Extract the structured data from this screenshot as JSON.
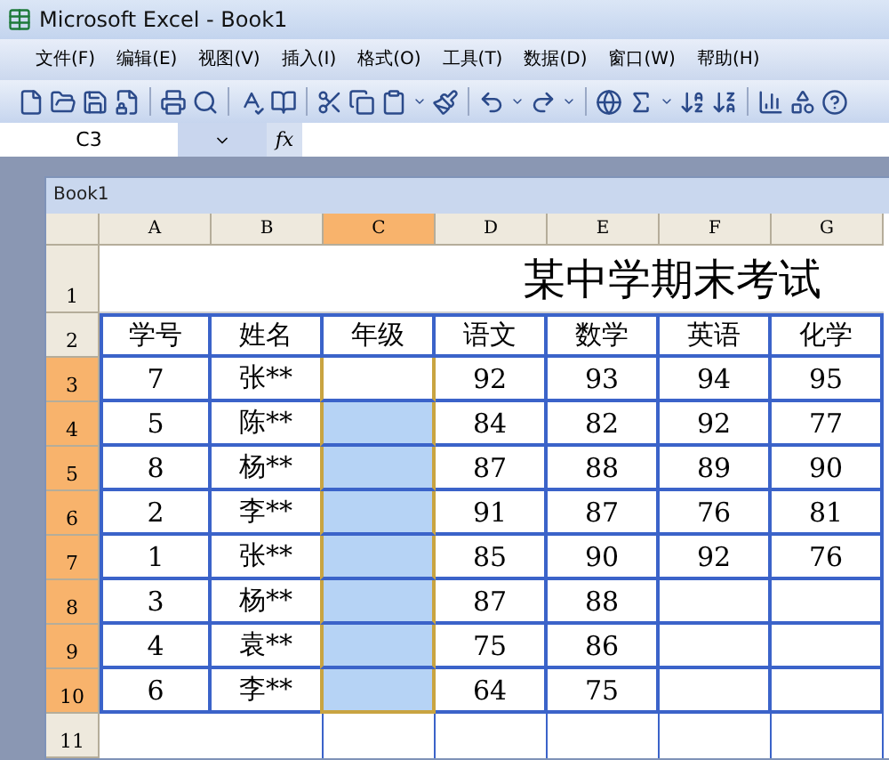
{
  "window": {
    "title": "Microsoft Excel - Book1"
  },
  "menu": [
    "文件(F)",
    "编辑(E)",
    "视图(V)",
    "插入(I)",
    "格式(O)",
    "工具(T)",
    "数据(D)",
    "窗口(W)",
    "帮助(H)"
  ],
  "name_box": "C3",
  "fx": "fx",
  "workbook": {
    "title": "Book1"
  },
  "columns": [
    {
      "label": "A",
      "selected": false
    },
    {
      "label": "B",
      "selected": false
    },
    {
      "label": "C",
      "selected": true
    },
    {
      "label": "D",
      "selected": false
    },
    {
      "label": "E",
      "selected": false
    },
    {
      "label": "F",
      "selected": false
    },
    {
      "label": "G",
      "selected": false
    }
  ],
  "sheet_title": "某中学期末考试",
  "header_row": {
    "number": "2",
    "cells": [
      "学号",
      "姓名",
      "年级",
      "语文",
      "数学",
      "英语",
      "化学"
    ]
  },
  "rows": [
    {
      "number": "3",
      "selected": true,
      "active": true,
      "id": "7",
      "name": "张**",
      "scores": [
        "92",
        "93",
        "94",
        "95"
      ]
    },
    {
      "number": "4",
      "selected": true,
      "active": false,
      "id": "5",
      "name": "陈**",
      "scores": [
        "84",
        "82",
        "92",
        "77"
      ]
    },
    {
      "number": "5",
      "selected": true,
      "active": false,
      "id": "8",
      "name": "杨**",
      "scores": [
        "87",
        "88",
        "89",
        "90"
      ]
    },
    {
      "number": "6",
      "selected": true,
      "active": false,
      "id": "2",
      "name": "李**",
      "scores": [
        "91",
        "87",
        "76",
        "81"
      ]
    },
    {
      "number": "7",
      "selected": true,
      "active": false,
      "id": "1",
      "name": "张**",
      "scores": [
        "85",
        "90",
        "92",
        "76"
      ]
    },
    {
      "number": "8",
      "selected": true,
      "active": false,
      "id": "3",
      "name": "杨**",
      "scores": [
        "87",
        "88"
      ]
    },
    {
      "number": "9",
      "selected": true,
      "active": false,
      "id": "4",
      "name": "袁**",
      "scores": [
        "75",
        "86"
      ]
    },
    {
      "number": "10",
      "selected": true,
      "active": false,
      "id": "6",
      "name": "李**",
      "scores": [
        "64",
        "75"
      ]
    }
  ],
  "title_row_number": "1",
  "empty_row_number": "11"
}
